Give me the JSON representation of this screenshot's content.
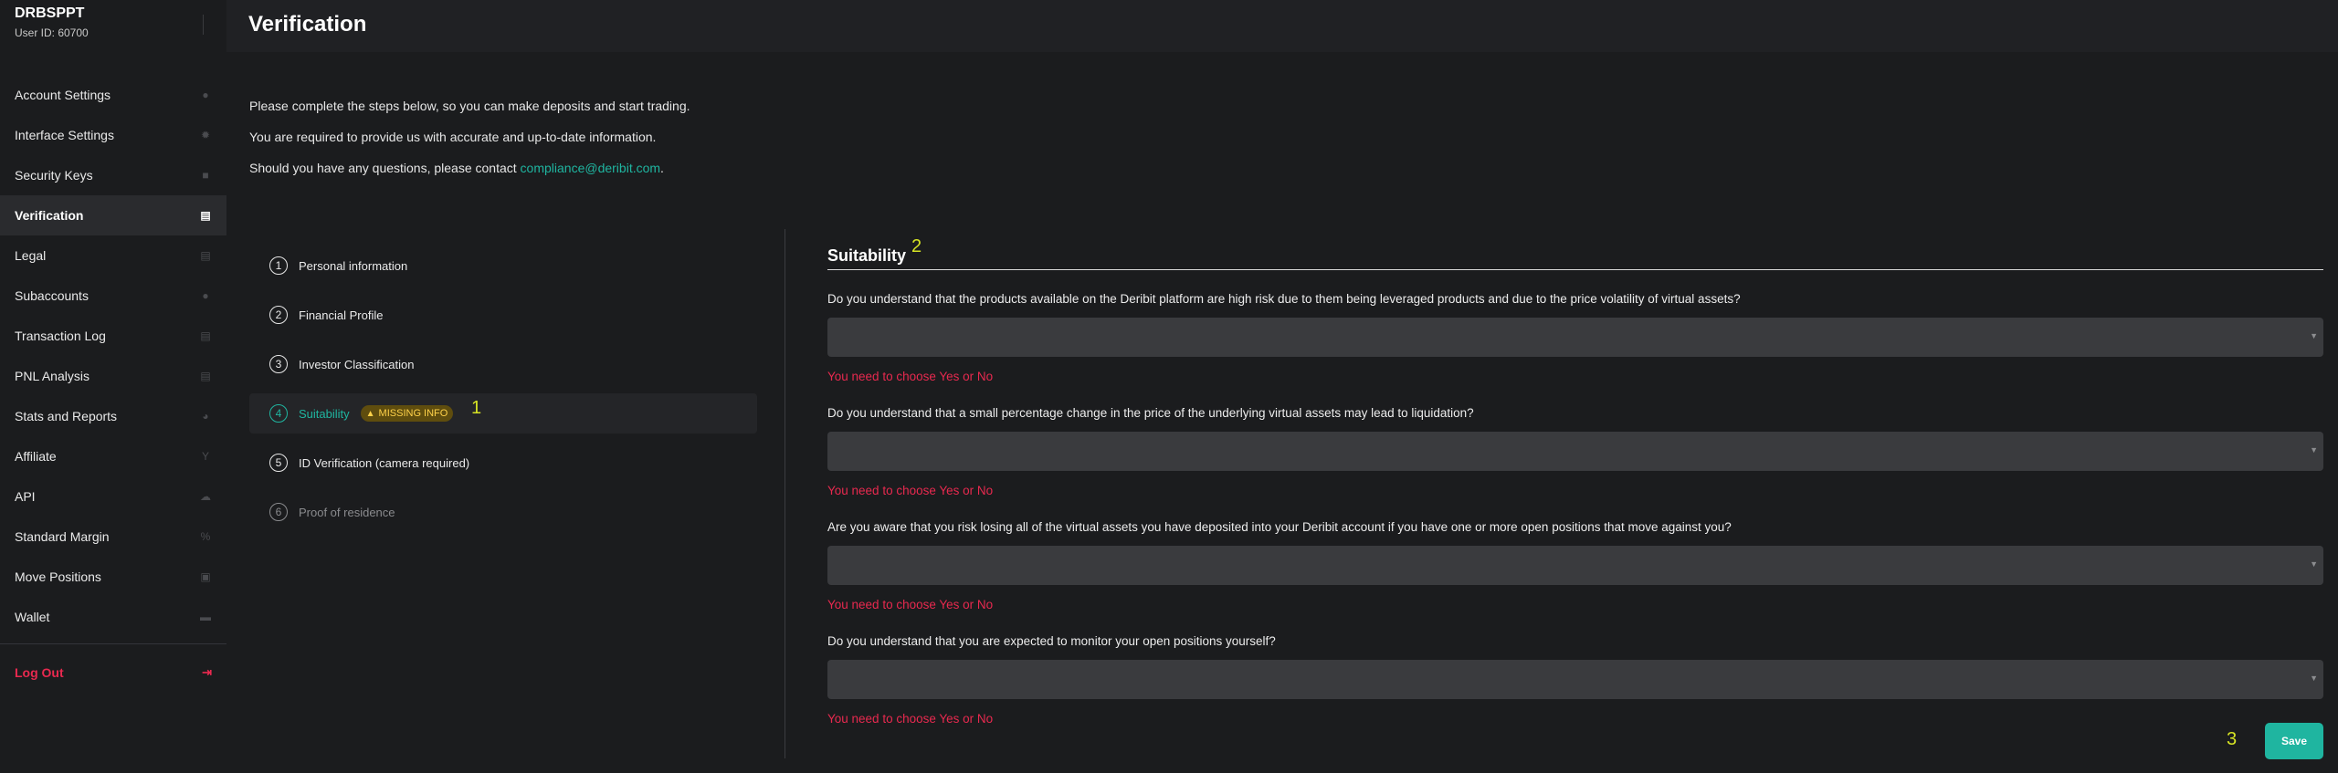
{
  "account": {
    "name": "DRBSPPT",
    "user_id": "User ID: 60700"
  },
  "page": {
    "title": "Verification"
  },
  "sidebar": {
    "items": [
      {
        "label": "Account Settings",
        "icon": "user-icon",
        "glyph": "●"
      },
      {
        "label": "Interface Settings",
        "icon": "gear-icon",
        "glyph": "✹"
      },
      {
        "label": "Security Keys",
        "icon": "lock-icon",
        "glyph": "■"
      },
      {
        "label": "Verification",
        "icon": "document-check-icon",
        "glyph": "▤"
      },
      {
        "label": "Legal",
        "icon": "document-icon",
        "glyph": "▤"
      },
      {
        "label": "Subaccounts",
        "icon": "users-icon",
        "glyph": "●"
      },
      {
        "label": "Transaction Log",
        "icon": "document-icon",
        "glyph": "▤"
      },
      {
        "label": "PNL Analysis",
        "icon": "document-icon",
        "glyph": "▤"
      },
      {
        "label": "Stats and Reports",
        "icon": "pie-chart-icon",
        "glyph": "◕"
      },
      {
        "label": "Affiliate",
        "icon": "branch-icon",
        "glyph": "Y"
      },
      {
        "label": "API",
        "icon": "cloud-icon",
        "glyph": "☁"
      },
      {
        "label": "Standard Margin",
        "icon": "percent-icon",
        "glyph": "%"
      },
      {
        "label": "Move Positions",
        "icon": "copy-icon",
        "glyph": "▣"
      },
      {
        "label": "Wallet",
        "icon": "wallet-icon",
        "glyph": "▬"
      }
    ],
    "active_index": 3,
    "logout_label": "Log Out"
  },
  "intro": {
    "line1": "Please complete the steps below, so you can make deposits and start trading.",
    "line2": "You are required to provide us with accurate and up-to-date information.",
    "line3_prefix": "Should you have any questions, please contact ",
    "email": "compliance@deribit.com",
    "line3_suffix": "."
  },
  "steps": [
    {
      "num": "1",
      "label": "Personal information"
    },
    {
      "num": "2",
      "label": "Financial Profile"
    },
    {
      "num": "3",
      "label": "Investor Classification"
    },
    {
      "num": "4",
      "label": "Suitability",
      "badge": "MISSING INFO"
    },
    {
      "num": "5",
      "label": "ID Verification (camera required)"
    },
    {
      "num": "6",
      "label": "Proof of residence"
    }
  ],
  "form": {
    "title": "Suitability",
    "questions": [
      {
        "label": "Do you understand that the products available on the Deribit platform are high risk due to them being leveraged products and due to the price volatility of virtual assets?",
        "value": "",
        "error": "You need to choose Yes or No"
      },
      {
        "label": "Do you understand that a small percentage change in the price of the underlying virtual assets may lead to liquidation?",
        "value": "",
        "error": "You need to choose Yes or No"
      },
      {
        "label": "Are you aware that you risk losing all of the virtual assets you have deposited into your Deribit account if you have one or more open positions that move against you?",
        "value": "",
        "error": "You need to choose Yes or No"
      },
      {
        "label": "Do you understand that you are expected to monitor your open positions yourself?",
        "value": "",
        "error": "You need to choose Yes or No"
      }
    ],
    "save_label": "Save"
  },
  "annotations": {
    "a1": "1",
    "a2": "2",
    "a3": "3"
  },
  "colors": {
    "accent": "#1fb5a0",
    "error": "#e8294f",
    "warning": "#ffd24a",
    "annotation": "#d6e324"
  }
}
